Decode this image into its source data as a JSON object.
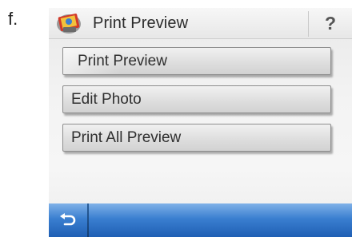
{
  "figure_label": "f.",
  "titlebar": {
    "title": "Print Preview",
    "help_label": "?"
  },
  "menu": {
    "items": [
      {
        "label": "Print Preview"
      },
      {
        "label": "Edit Photo"
      },
      {
        "label": "Print All Preview"
      }
    ]
  },
  "bottombar": {
    "back_icon": "back-arrow-icon"
  },
  "colors": {
    "accent_blue": "#2f6fc4",
    "button_border": "#8d8d8d",
    "text": "#2f2f2f"
  }
}
